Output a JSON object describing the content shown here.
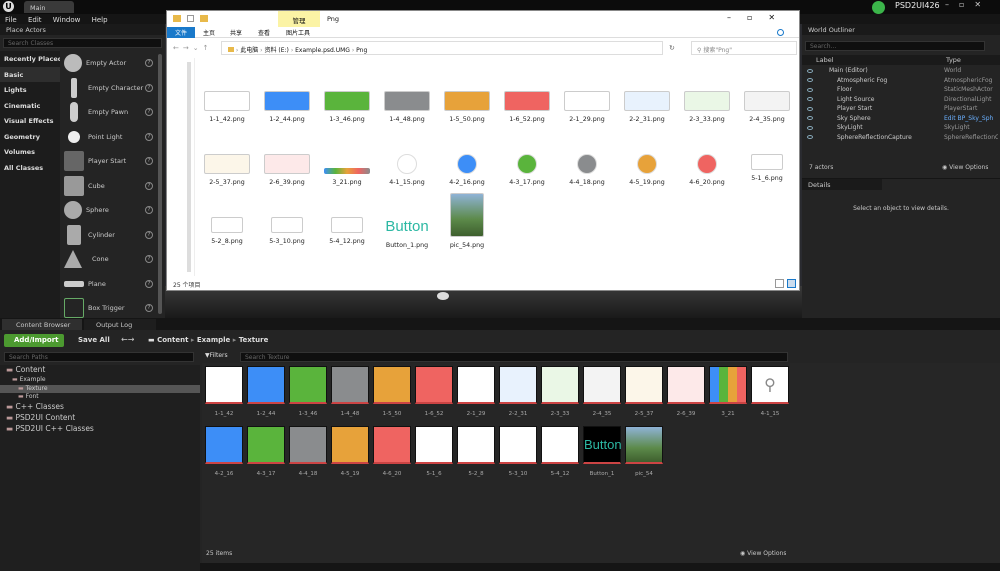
{
  "titlebar": {
    "tab_label": "Main",
    "project_name": "PSD2UI426"
  },
  "menu": [
    "File",
    "Edit",
    "Window",
    "Help"
  ],
  "place_actors": {
    "title": "Place Actors",
    "search_placeholder": "Search Classes",
    "categories": [
      "Recently Placed",
      "Basic",
      "Lights",
      "Cinematic",
      "Visual Effects",
      "Geometry",
      "Volumes",
      "All Classes"
    ],
    "selected_category": "Basic",
    "actors": [
      "Empty Actor",
      "Empty Character",
      "Empty Pawn",
      "Point Light",
      "Player Start",
      "Cube",
      "Sphere",
      "Cylinder",
      "Cone",
      "Plane",
      "Box Trigger"
    ]
  },
  "explorer": {
    "tab_label": "管理",
    "window_title": "Png",
    "ribbon_tabs": [
      "文件",
      "主页",
      "共享",
      "查看"
    ],
    "ribbon_context": "图片工具",
    "path": [
      "此电脑",
      "资料 (E:)",
      "Example.psd.UMG",
      "Png"
    ],
    "search_placeholder": "搜索\"Png\"",
    "status": "25 个项目",
    "files": [
      {
        "name": "1-1_42.png",
        "color": "#ffffff"
      },
      {
        "name": "1-2_44.png",
        "color": "#3d8ef7"
      },
      {
        "name": "1-3_46.png",
        "color": "#5ab43c"
      },
      {
        "name": "1-4_48.png",
        "color": "#8a8c8e"
      },
      {
        "name": "1-5_50.png",
        "color": "#e7a23a"
      },
      {
        "name": "1-6_52.png",
        "color": "#ef6461"
      },
      {
        "name": "2-1_29.png",
        "color": "#ffffff"
      },
      {
        "name": "2-2_31.png",
        "color": "#e8f2fd"
      },
      {
        "name": "2-3_33.png",
        "color": "#eaf7e6"
      },
      {
        "name": "2-4_35.png",
        "color": "#f3f3f3"
      },
      {
        "name": "2-5_37.png",
        "color": "#fcf6e9"
      },
      {
        "name": "2-6_39.png",
        "color": "#fde9e9"
      },
      {
        "name": "3_21.png",
        "color": "#cccccc"
      },
      {
        "name": "4-1_15.png",
        "color": "#ffffff"
      },
      {
        "name": "4-2_16.png",
        "color": "#3d8ef7"
      },
      {
        "name": "4-3_17.png",
        "color": "#5ab43c"
      },
      {
        "name": "4-4_18.png",
        "color": "#8a8c8e"
      },
      {
        "name": "4-5_19.png",
        "color": "#e7a23a"
      },
      {
        "name": "4-6_20.png",
        "color": "#ef6461"
      },
      {
        "name": "5-1_6.png",
        "color": "#ffffff"
      },
      {
        "name": "5-2_8.png",
        "color": "#ffffff"
      },
      {
        "name": "5-3_10.png",
        "color": "#ffffff"
      },
      {
        "name": "5-4_12.png",
        "color": "#ffffff"
      },
      {
        "name": "Button_1.png",
        "color": "#ffffff"
      },
      {
        "name": "pic_54.png",
        "color": "#4a7a3a"
      }
    ],
    "button_text": "Button"
  },
  "outliner": {
    "title": "World Outliner",
    "search_placeholder": "Search...",
    "col_label": "Label",
    "col_type": "Type",
    "rows": [
      {
        "label": "Main (Editor)",
        "type": "World"
      },
      {
        "label": "Atmospheric Fog",
        "type": "AtmosphericFog"
      },
      {
        "label": "Floor",
        "type": "StaticMeshActor"
      },
      {
        "label": "Light Source",
        "type": "DirectionalLight"
      },
      {
        "label": "Player Start",
        "type": "PlayerStart"
      },
      {
        "label": "Sky Sphere",
        "type": "Edit BP_Sky_Sph"
      },
      {
        "label": "SkyLight",
        "type": "SkyLight"
      },
      {
        "label": "SphereReflectionCapture",
        "type": "SphereReflectionC"
      }
    ],
    "actor_count": "7 actors",
    "view_options": "View Options"
  },
  "details": {
    "title": "Details",
    "empty_msg": "Select an object to view details."
  },
  "content_browser": {
    "tab_content": "Content Browser",
    "tab_output": "Output Log",
    "add_import": "Add/Import",
    "save_all": "Save All",
    "breadcrumb": [
      "Content",
      "Example",
      "Texture"
    ],
    "search_paths_placeholder": "Search Paths",
    "filters_label": "Filters",
    "search_texture_placeholder": "Search Texture",
    "tree": [
      {
        "label": "Content",
        "indent": 0
      },
      {
        "label": "Example",
        "indent": 1
      },
      {
        "label": "Texture",
        "indent": 2
      },
      {
        "label": "Font",
        "indent": 2
      },
      {
        "label": "C++ Classes",
        "indent": 0
      },
      {
        "label": "PSD2UI Content",
        "indent": 0
      },
      {
        "label": "PSD2UI C++ Classes",
        "indent": 0
      }
    ],
    "assets": [
      {
        "name": "1-1_42",
        "color": "#ffffff"
      },
      {
        "name": "1-2_44",
        "color": "#3d8ef7"
      },
      {
        "name": "1-3_46",
        "color": "#5ab43c"
      },
      {
        "name": "1-4_48",
        "color": "#8a8c8e"
      },
      {
        "name": "1-5_50",
        "color": "#e7a23a"
      },
      {
        "name": "1-6_52",
        "color": "#ef6461"
      },
      {
        "name": "2-1_29",
        "color": "#ffffff"
      },
      {
        "name": "2-2_31",
        "color": "#e8f2fd"
      },
      {
        "name": "2-3_33",
        "color": "#eaf7e6"
      },
      {
        "name": "2-4_35",
        "color": "#f3f3f3"
      },
      {
        "name": "2-5_37",
        "color": "#fcf6e9"
      },
      {
        "name": "2-6_39",
        "color": "#fde9e9"
      },
      {
        "name": "3_21",
        "color": "#cccccc"
      },
      {
        "name": "4-1_15",
        "color": "#ffffff"
      },
      {
        "name": "4-2_16",
        "color": "#3d8ef7"
      },
      {
        "name": "4-3_17",
        "color": "#5ab43c"
      },
      {
        "name": "4-4_18",
        "color": "#8a8c8e"
      },
      {
        "name": "4-5_19",
        "color": "#e7a23a"
      },
      {
        "name": "4-6_20",
        "color": "#ef6461"
      },
      {
        "name": "5-1_6",
        "color": "#ffffff"
      },
      {
        "name": "5-2_8",
        "color": "#ffffff"
      },
      {
        "name": "5-3_10",
        "color": "#ffffff"
      },
      {
        "name": "5-4_12",
        "color": "#ffffff"
      },
      {
        "name": "Button_1",
        "color": "#000000"
      },
      {
        "name": "pic_54",
        "color": "#4a7a3a"
      }
    ],
    "item_count": "25 items",
    "view_options": "View Options"
  }
}
